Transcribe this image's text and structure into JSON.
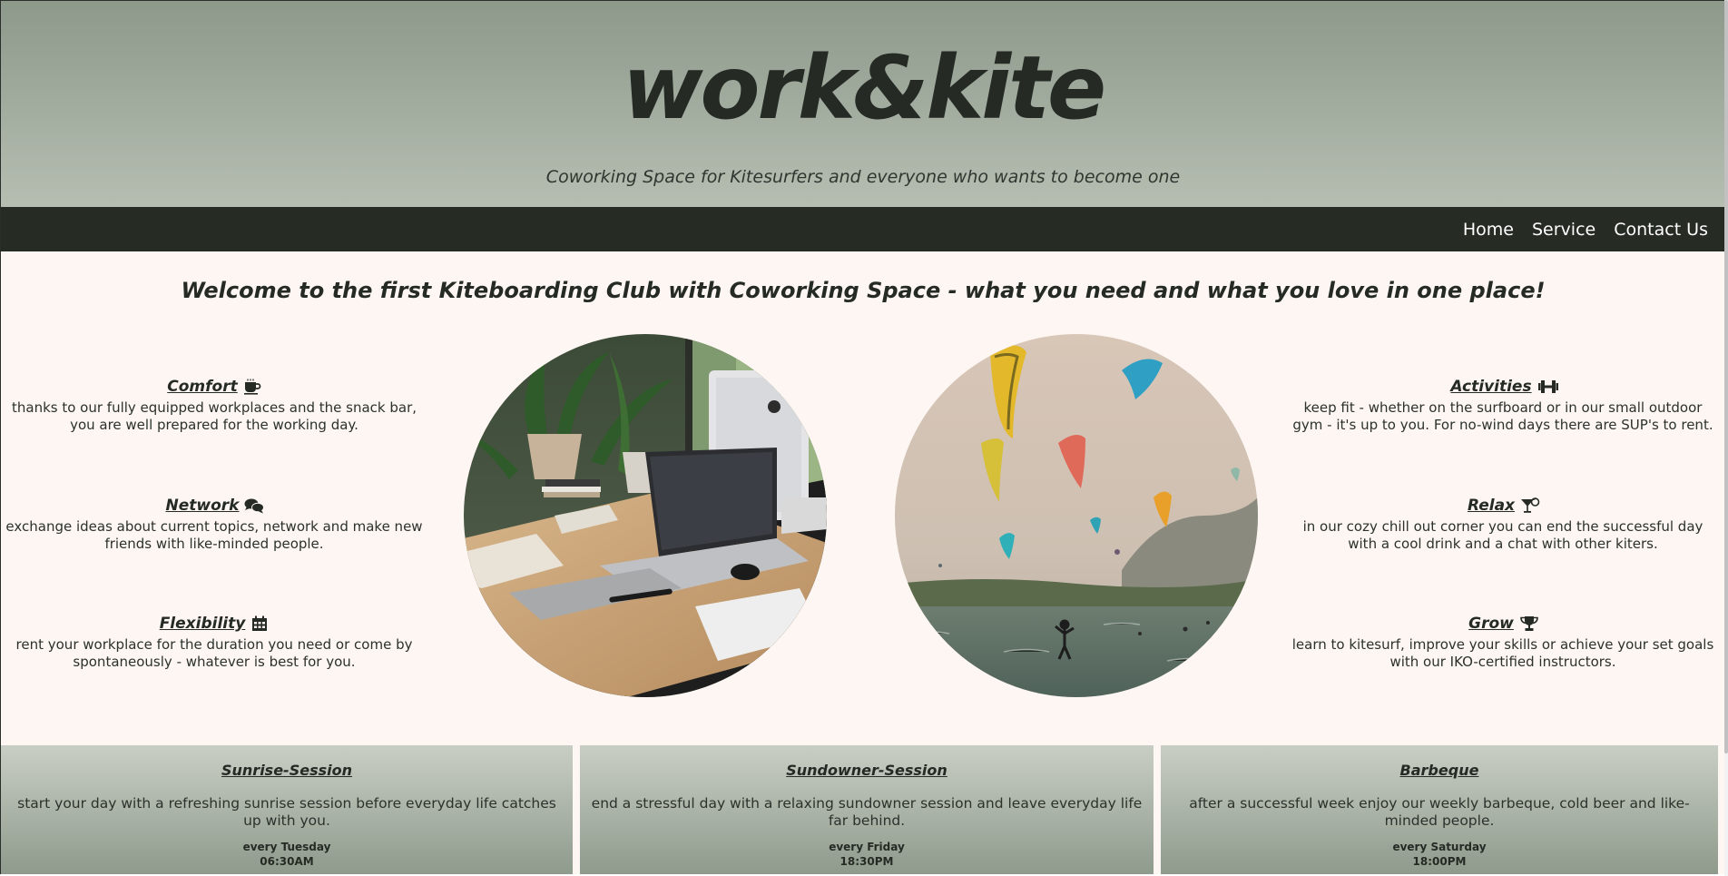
{
  "header": {
    "logo": "work&kite",
    "tagline": "Coworking Space for Kitesurfers and everyone who wants to become one"
  },
  "nav": {
    "items": [
      {
        "label": "Home"
      },
      {
        "label": "Service"
      },
      {
        "label": "Contact Us"
      }
    ]
  },
  "welcome": "Welcome to the first Kiteboarding Club with Coworking Space - what you need and what you love in one place!",
  "features_left": [
    {
      "title": "Comfort",
      "icon": "coffee-icon",
      "text": "thanks to our fully equipped workplaces and the snack bar, you are well prepared for the working day."
    },
    {
      "title": "Network",
      "icon": "comments-icon",
      "text": "exchange ideas about current topics, network and make new friends with like-minded people."
    },
    {
      "title": "Flexibility",
      "icon": "calendar-icon",
      "text": "rent your workplace for the duration you need or come by spontaneously - whatever is best for you."
    }
  ],
  "features_right": [
    {
      "title": "Activities",
      "icon": "dumbbell-icon",
      "text": "keep fit - whether on the surfboard or in our small outdoor gym - it's up to you. For no-wind days there are SUP's to rent."
    },
    {
      "title": "Relax",
      "icon": "cocktail-icon",
      "text": "in our cozy chill out corner you can end the successful day with a cool drink and a chat with other kiters."
    },
    {
      "title": "Grow",
      "icon": "trophy-icon",
      "text": "learn to kitesurf, improve your skills or achieve your set goals with our IKO-certified instructors."
    }
  ],
  "images": {
    "workspace": "workspace-photo",
    "kites": "kitesurfing-photo"
  },
  "events": [
    {
      "title": "Sunrise-Session",
      "text": "start your day with a refreshing sunrise session before everyday life catches up with you.",
      "day": "every Tuesday",
      "time": "06:30AM"
    },
    {
      "title": "Sundowner-Session",
      "text": "end a stressful day with a relaxing sundowner session and leave everyday life far behind.",
      "day": "every Friday",
      "time": "18:30PM"
    },
    {
      "title": "Barbeque",
      "text": "after a successful week enjoy our weekly barbeque, cold beer and like-minded people.",
      "day": "every Saturday",
      "time": "18:00PM"
    }
  ],
  "colors": {
    "header_top": "#8d998a",
    "header_bottom": "#b6beb2",
    "nav_bg": "#262b24",
    "page_bg": "#fdf6f2",
    "text": "#252a25"
  }
}
